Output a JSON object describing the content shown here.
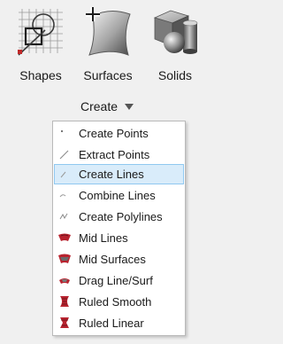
{
  "toolbar": {
    "tools": [
      {
        "label": "Shapes",
        "icon": "shapes-icon"
      },
      {
        "label": "Surfaces",
        "icon": "surfaces-icon"
      },
      {
        "label": "Solids",
        "icon": "solids-icon"
      }
    ],
    "create_label": "Create"
  },
  "menu": {
    "selected_index": 2,
    "items": [
      {
        "label": "Create Points",
        "icon": "point-icon"
      },
      {
        "label": "Extract Points",
        "icon": "extract-point-icon"
      },
      {
        "label": "Create Lines",
        "icon": "line-icon"
      },
      {
        "label": "Combine Lines",
        "icon": "combine-lines-icon"
      },
      {
        "label": "Create Polylines",
        "icon": "polyline-icon"
      },
      {
        "label": "Mid Lines",
        "icon": "mid-lines-icon"
      },
      {
        "label": "Mid Surfaces",
        "icon": "mid-surfaces-icon"
      },
      {
        "label": "Drag Line/Surf",
        "icon": "drag-line-surf-icon"
      },
      {
        "label": "Ruled Smooth",
        "icon": "ruled-smooth-icon"
      },
      {
        "label": "Ruled Linear",
        "icon": "ruled-linear-icon"
      }
    ]
  },
  "colors": {
    "selection_fill": "#d9ecfa",
    "selection_border": "#90c8f0",
    "accent_red": "#b8232f"
  }
}
